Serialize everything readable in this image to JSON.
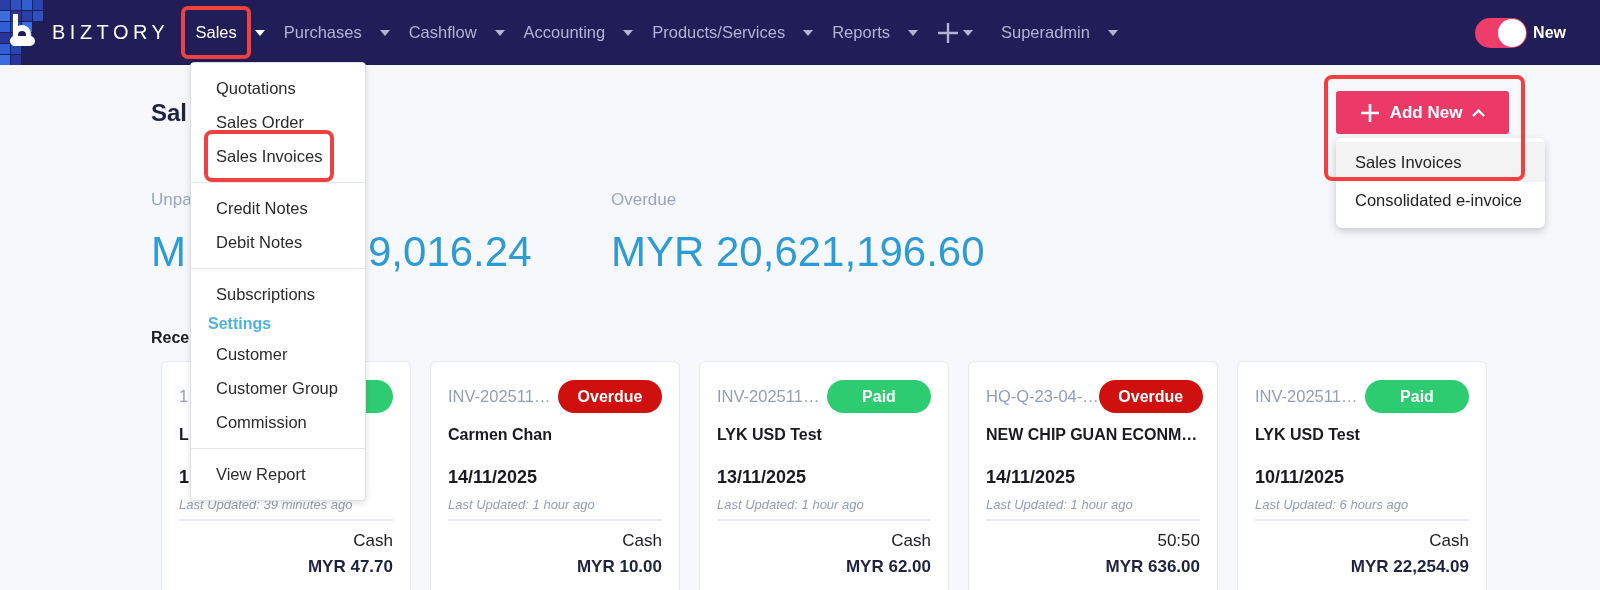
{
  "nav": {
    "brand": "BIZTORY",
    "items": [
      {
        "kind": "text",
        "label": "Sales",
        "selected": true,
        "highlighted": true
      },
      {
        "kind": "text",
        "label": "Purchases",
        "selected": false,
        "highlighted": false
      },
      {
        "kind": "text",
        "label": "Cashflow",
        "selected": false,
        "highlighted": false
      },
      {
        "kind": "text",
        "label": "Accounting",
        "selected": false,
        "highlighted": false
      },
      {
        "kind": "text",
        "label": "Products/Services",
        "selected": false,
        "highlighted": false
      },
      {
        "kind": "text",
        "label": "Reports",
        "selected": false,
        "highlighted": false
      },
      {
        "kind": "add",
        "selected": false,
        "highlighted": false
      },
      {
        "kind": "text",
        "label": "Superadmin",
        "selected": false,
        "highlighted": false
      }
    ],
    "toggle": {
      "on": true,
      "label": "New"
    }
  },
  "page": {
    "title": "Sal",
    "add_new": {
      "label": "Add New",
      "expanded": true,
      "highlighted": true,
      "options": [
        {
          "label": "Sales Invoices",
          "selected": true
        },
        {
          "label": "Consolidated e-invoice",
          "selected": false
        }
      ]
    },
    "summary": [
      {
        "label": "Unpa",
        "amount_parts": [
          "M",
          "9,016.24"
        ]
      },
      {
        "label": "Overdue",
        "amount_parts": [
          "MYR 20,621,196.60"
        ]
      }
    ],
    "recent_heading": "Rece",
    "cards": [
      {
        "number": "1",
        "color": "#2ecc71",
        "customer": "L",
        "date": "1",
        "updated": "Last Updated: 39 minutes ago",
        "payment": "Cash",
        "total": "MYR 47.70"
      },
      {
        "number": "INV-202511…",
        "color": "#d0100f",
        "status_label": "Overdue",
        "customer": "Carmen Chan",
        "date": "14/11/2025",
        "updated": "Last Updated: 1 hour ago",
        "payment": "Cash",
        "total": "MYR 10.00"
      },
      {
        "number": "INV-202511…",
        "color": "#2ecc71",
        "status_label": "Paid",
        "customer": "LYK USD Test",
        "date": "13/11/2025",
        "updated": "Last Updated: 1 hour ago",
        "payment": "Cash",
        "total": "MYR 62.00"
      },
      {
        "number": "HQ-Q-23-04-…",
        "color": "#d0100f",
        "status_label": "Overdue",
        "customer": "NEW CHIP GUAN ECONM…",
        "date": "14/11/2025",
        "updated": "Last Updated: 1 hour ago",
        "payment": "50:50",
        "total": "MYR 636.00"
      },
      {
        "number": "INV-202511…",
        "color": "#2ecc71",
        "status_label": "Paid",
        "customer": "LYK USD Test",
        "date": "10/11/2025",
        "updated": "Last Updated: 6 hours ago",
        "payment": "Cash",
        "total": "MYR 22,254.09"
      }
    ]
  },
  "sales_menu": {
    "sections": [
      {
        "items": [
          {
            "kind": "link",
            "label": "Quotations",
            "highlighted": false
          },
          {
            "kind": "link",
            "label": "Sales Order",
            "highlighted": false
          },
          {
            "kind": "link",
            "label": "Sales Invoices",
            "highlighted": true
          }
        ]
      },
      {
        "items": [
          {
            "kind": "link",
            "label": "Credit Notes",
            "highlighted": false
          },
          {
            "kind": "link",
            "label": "Debit Notes",
            "highlighted": false
          }
        ]
      },
      {
        "items": [
          {
            "kind": "link",
            "label": "Subscriptions",
            "highlighted": false
          },
          {
            "kind": "heading",
            "label": "Settings"
          },
          {
            "kind": "link",
            "label": "Customer",
            "highlighted": false
          },
          {
            "kind": "link",
            "label": "Customer Group",
            "highlighted": false
          },
          {
            "kind": "link",
            "label": "Commission",
            "highlighted": false
          }
        ]
      },
      {
        "items": [
          {
            "kind": "link",
            "label": "View Report",
            "highlighted": false
          }
        ]
      }
    ]
  }
}
